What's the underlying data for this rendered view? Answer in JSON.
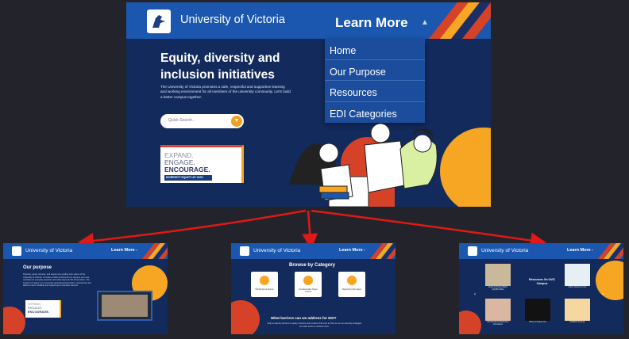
{
  "main": {
    "brand": "University of Victoria",
    "learn_more": "Learn More",
    "menu": [
      "Home",
      "Our Purpose",
      "Resources",
      "EDI Categories"
    ],
    "title_line1": "Equity, diversity and",
    "title_line2": "inclusion initiatives",
    "paragraph": "The University of Victoria promotes a safe, respectful and supportive learning and working environment for all members of the university community. Let's build a better campus together.",
    "search_placeholder": "Quick Search...",
    "card": {
      "line1": "EXPAND.",
      "line2": "ENGAGE.",
      "line3": "ENCOURAGE.",
      "tag": "DIVERSITY EQUITY AT UVIC"
    }
  },
  "sub_purpose": {
    "brand": "University of Victoria",
    "learn_more": "Learn More -",
    "title": "Our purpose",
    "text": "Diversity, equity, fairness, and respect are guiding core values of the University of Victoria. To foster an EDI environment on campus, we must consider our everyday practices and what steps can lift all members. The impacts of values in our everyday educational interaction, experiences and advice to aid in building and supporting an inclusive campus.",
    "card": {
      "line1": "EXPAND.",
      "line2": "ENGAGE.",
      "line3": "ENCOURAGE."
    }
  },
  "sub_browse": {
    "brand": "University of Victoria",
    "learn_more": "Learn More -",
    "title": "Browse by Category",
    "categories": [
      "Workshops & Events",
      "Fundamentals Target Letters",
      "Reporting Information"
    ],
    "question": "What barriers can we address for EDI?",
    "text": "Help us identify barriers to equity, diversity and inclusion that exist at UVic so we can develop strategies and take action to address them."
  },
  "sub_resources": {
    "brand": "University of Victoria",
    "learn_more": "Learn More -",
    "center_label": "Resources On UVIC Campus",
    "items": [
      "Equity & Human Rights (EQHR) Office",
      "Native Students Union",
      "EDI Faculty & Department Committees",
      "Office of Student Life",
      "Multifaith Services"
    ]
  },
  "colors": {
    "navy": "#122a5c",
    "header_blue": "#1b57ae",
    "orange": "#f6a623",
    "red": "#d64228"
  }
}
